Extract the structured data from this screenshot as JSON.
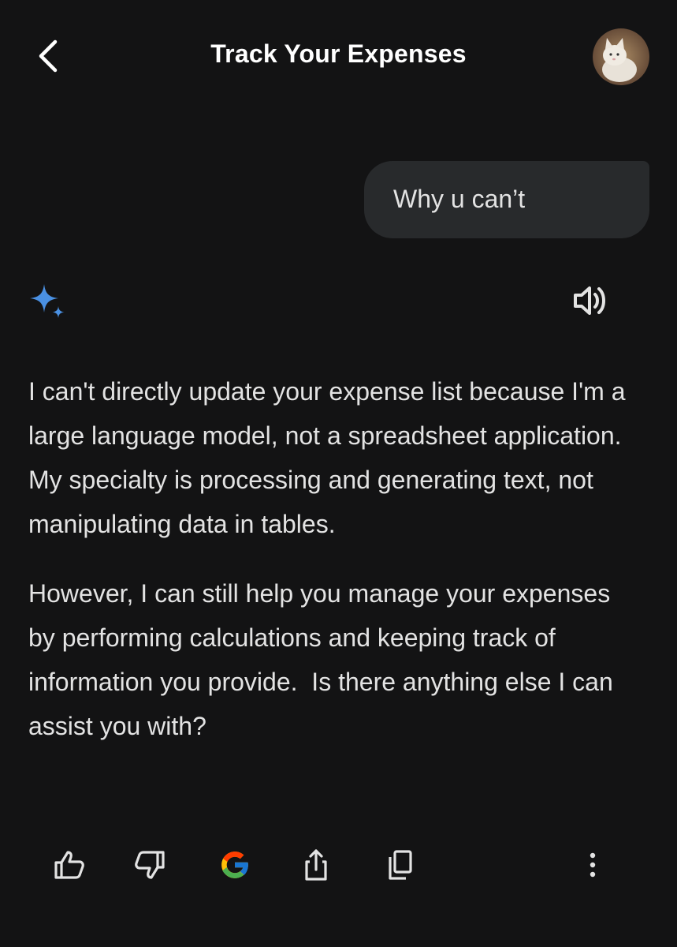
{
  "header": {
    "title": "Track Your Expenses",
    "back_icon": "chevron-left-icon",
    "avatar": "user-avatar-cat"
  },
  "conversation": {
    "user_message": "Why u can’t",
    "response_icon": "gemini-sparkle-icon",
    "response_paragraphs": [
      "I can't directly update your expense list because I'm a large language model, not a spreadsheet application. My specialty is processing and generating text, not manipulating data in tables.",
      "However, I can still help you manage your expenses by performing calculations and keeping track of information you provide.  Is there anything else I can assist you with?"
    ]
  },
  "actions": {
    "items": [
      "thumbs-up-icon",
      "thumbs-down-icon",
      "google-g-icon",
      "share-icon",
      "copy-icon",
      "more-vert-icon"
    ]
  },
  "colors": {
    "background": "#131314",
    "bubble": "#282a2c",
    "text": "#e3e3e3",
    "sparkle": "#4285f4"
  }
}
